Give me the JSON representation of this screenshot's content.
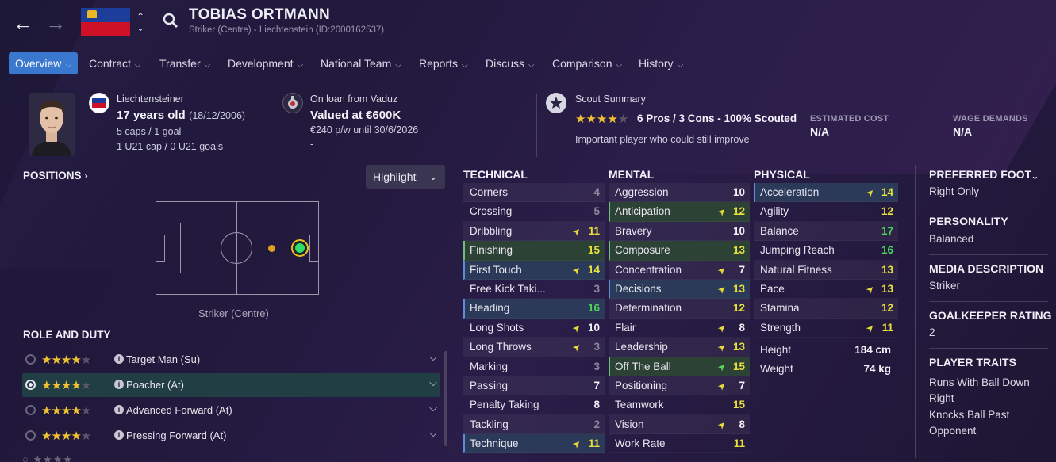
{
  "player": {
    "name": "TOBIAS ORTMANN",
    "subtitle": "Striker (Centre) - Liechtenstein (ID:2000162537)"
  },
  "tabs": [
    {
      "label": "Overview",
      "active": true
    },
    {
      "label": "Contract"
    },
    {
      "label": "Transfer"
    },
    {
      "label": "Development"
    },
    {
      "label": "National Team"
    },
    {
      "label": "Reports"
    },
    {
      "label": "Discuss"
    },
    {
      "label": "Comparison"
    },
    {
      "label": "History"
    }
  ],
  "info": {
    "nationality": "Liechtensteiner",
    "age": "17 years old",
    "dob": "(18/12/2006)",
    "caps": "5 caps / 1 goal",
    "u21": "1 U21 cap / 0 U21 goals",
    "loan_label": "On loan from Vaduz",
    "value": "Valued at €600K",
    "wage": "€240 p/w until 30/6/2026",
    "wage_extra": "-",
    "scout_label": "Scout Summary",
    "scout_stars": 4,
    "scout_text": "6 Pros / 3 Cons - 100% Scouted",
    "scout_note": "Important player who could still improve",
    "est_cost_label": "ESTIMATED COST",
    "est_cost_value": "N/A",
    "wage_demands_label": "WAGE DEMANDS",
    "wage_demands_value": "N/A"
  },
  "positions": {
    "title": "POSITIONS",
    "highlight": "Highlight",
    "label": "Striker (Centre)"
  },
  "roles": {
    "title": "ROLE AND DUTY",
    "items": [
      {
        "name": "Target Man (Su)",
        "stars": 4,
        "selected": false
      },
      {
        "name": "Poacher (At)",
        "stars": 4,
        "selected": true
      },
      {
        "name": "Advanced Forward (At)",
        "stars": 4,
        "selected": false
      },
      {
        "name": "Pressing Forward (At)",
        "stars": 4,
        "selected": false
      }
    ]
  },
  "technical": {
    "title": "TECHNICAL",
    "attrs": [
      {
        "name": "Corners",
        "value": "4",
        "color": "grey"
      },
      {
        "name": "Crossing",
        "value": "5",
        "color": "grey"
      },
      {
        "name": "Dribbling",
        "value": "11",
        "color": "yellow",
        "arrow": "up"
      },
      {
        "name": "Finishing",
        "value": "15",
        "color": "yellow",
        "hl": "green"
      },
      {
        "name": "First Touch",
        "value": "14",
        "color": "yellow",
        "arrow": "up",
        "hl": "blue"
      },
      {
        "name": "Free Kick Taki...",
        "value": "3",
        "color": "grey"
      },
      {
        "name": "Heading",
        "value": "16",
        "color": "green",
        "hl": "blue"
      },
      {
        "name": "Long Shots",
        "value": "10",
        "color": "white",
        "arrow": "up"
      },
      {
        "name": "Long Throws",
        "value": "3",
        "color": "grey",
        "arrow": "up"
      },
      {
        "name": "Marking",
        "value": "3",
        "color": "grey"
      },
      {
        "name": "Passing",
        "value": "7",
        "color": "white"
      },
      {
        "name": "Penalty Taking",
        "value": "8",
        "color": "white"
      },
      {
        "name": "Tackling",
        "value": "2",
        "color": "grey"
      },
      {
        "name": "Technique",
        "value": "11",
        "color": "yellow",
        "arrow": "up",
        "hl": "blue"
      }
    ]
  },
  "mental": {
    "title": "MENTAL",
    "attrs": [
      {
        "name": "Aggression",
        "value": "10",
        "color": "white"
      },
      {
        "name": "Anticipation",
        "value": "12",
        "color": "yellow",
        "arrow": "up",
        "hl": "green"
      },
      {
        "name": "Bravery",
        "value": "10",
        "color": "white"
      },
      {
        "name": "Composure",
        "value": "13",
        "color": "yellow",
        "hl": "green"
      },
      {
        "name": "Concentration",
        "value": "7",
        "color": "white",
        "arrow": "up"
      },
      {
        "name": "Decisions",
        "value": "13",
        "color": "yellow",
        "arrow": "up",
        "hl": "blue"
      },
      {
        "name": "Determination",
        "value": "12",
        "color": "yellow"
      },
      {
        "name": "Flair",
        "value": "8",
        "color": "white",
        "arrow": "up"
      },
      {
        "name": "Leadership",
        "value": "13",
        "color": "yellow",
        "arrow": "up"
      },
      {
        "name": "Off The Ball",
        "value": "15",
        "color": "yellow",
        "arrow": "upgreen",
        "hl": "green"
      },
      {
        "name": "Positioning",
        "value": "7",
        "color": "white",
        "arrow": "up"
      },
      {
        "name": "Teamwork",
        "value": "15",
        "color": "yellow"
      },
      {
        "name": "Vision",
        "value": "8",
        "color": "white",
        "arrow": "up"
      },
      {
        "name": "Work Rate",
        "value": "11",
        "color": "yellow"
      }
    ]
  },
  "physical": {
    "title": "PHYSICAL",
    "attrs": [
      {
        "name": "Acceleration",
        "value": "14",
        "color": "yellow",
        "arrow": "up",
        "hl": "blue"
      },
      {
        "name": "Agility",
        "value": "12",
        "color": "yellow"
      },
      {
        "name": "Balance",
        "value": "17",
        "color": "green"
      },
      {
        "name": "Jumping Reach",
        "value": "16",
        "color": "green"
      },
      {
        "name": "Natural Fitness",
        "value": "13",
        "color": "yellow"
      },
      {
        "name": "Pace",
        "value": "13",
        "color": "yellow",
        "arrow": "up"
      },
      {
        "name": "Stamina",
        "value": "12",
        "color": "yellow"
      },
      {
        "name": "Strength",
        "value": "11",
        "color": "yellow",
        "arrow": "up"
      }
    ],
    "height_label": "Height",
    "height": "184 cm",
    "weight_label": "Weight",
    "weight": "74 kg"
  },
  "side": {
    "foot_title": "PREFERRED FOOT",
    "foot": "Right Only",
    "personality_title": "PERSONALITY",
    "personality": "Balanced",
    "media_title": "MEDIA DESCRIPTION",
    "media": "Striker",
    "gk_title": "GOALKEEPER RATING",
    "gk": "2",
    "traits_title": "PLAYER TRAITS",
    "traits": [
      "Runs With Ball Down Right",
      "Knocks Ball Past Opponent"
    ]
  }
}
